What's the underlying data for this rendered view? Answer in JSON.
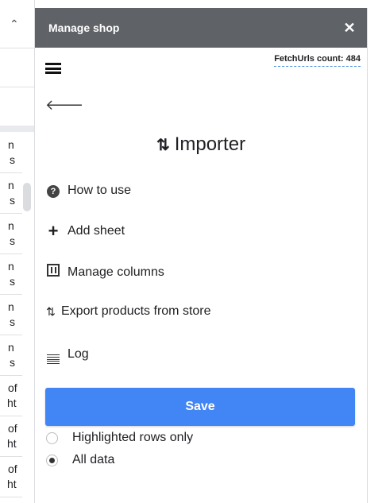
{
  "sheet": {
    "rows": [
      {
        "a": "n",
        "b": "s"
      },
      {
        "a": "n",
        "b": "s"
      },
      {
        "a": "n",
        "b": "s"
      },
      {
        "a": "n",
        "b": "s"
      },
      {
        "a": "n",
        "b": "s"
      },
      {
        "a": "n",
        "b": "s"
      },
      {
        "a": "of",
        "b": "ht"
      },
      {
        "a": "of",
        "b": "ht"
      },
      {
        "a": "of",
        "b": "ht"
      }
    ]
  },
  "panel": {
    "title": "Manage shop",
    "close_glyph": "✕",
    "fetch_label": "FetchUrls count: 484",
    "back_glyph": "🡐",
    "heading_arrows": "⇅",
    "heading": "Importer",
    "menu": [
      {
        "label": "How to use",
        "icon": "help-circle-icon"
      },
      {
        "label": "Add sheet",
        "icon": "plus-icon"
      },
      {
        "label": "Manage columns",
        "icon": "columns-icon"
      },
      {
        "label": "Export products from store",
        "icon": "import-export-icon"
      },
      {
        "label": "Log",
        "icon": "lines-icon"
      }
    ],
    "save_label": "Save",
    "radios": [
      {
        "label": "Highlighted rows only",
        "checked": false
      },
      {
        "label": "All data",
        "checked": true
      }
    ]
  },
  "colors": {
    "header_bg": "#5f6368",
    "save_bg": "#4285f4"
  }
}
